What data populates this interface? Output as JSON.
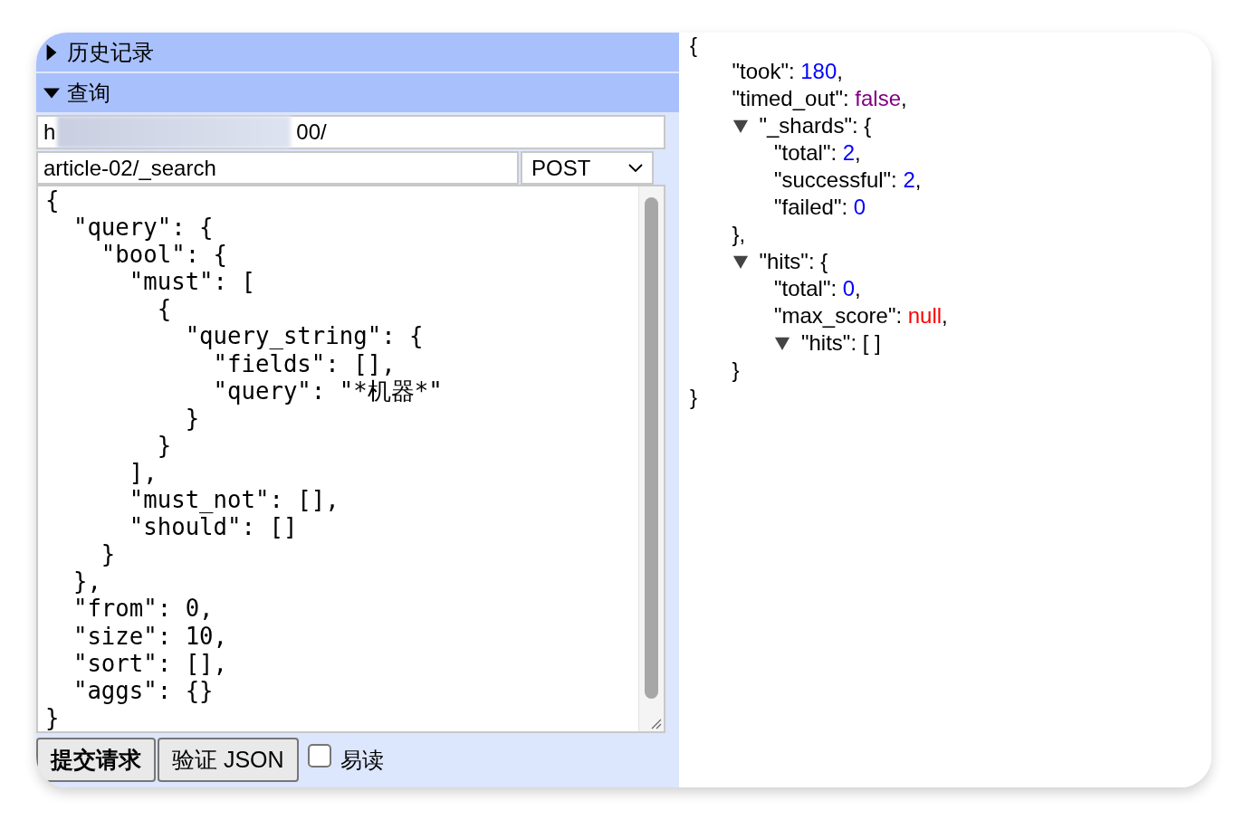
{
  "sections": [
    {
      "title": "历史记录",
      "expanded": false
    },
    {
      "title": "查询",
      "expanded": true
    }
  ],
  "query": {
    "url": {
      "prefix": "h",
      "suffix": "00/",
      "redacted": true
    },
    "path": "article-02/_search",
    "method": "POST",
    "body": "{\n  \"query\": {\n    \"bool\": {\n      \"must\": [\n        {\n          \"query_string\": {\n            \"fields\": [],\n            \"query\": \"*机器*\"\n          }\n        }\n      ],\n      \"must_not\": [],\n      \"should\": []\n    }\n  },\n  \"from\": 0,\n  \"size\": 10,\n  \"sort\": [],\n  \"aggs\": {}\n}"
  },
  "buttons": [
    {
      "label": "提交请求",
      "bold": true
    },
    {
      "label": "验证 JSON",
      "bold": false
    }
  ],
  "readable": {
    "label": "易读",
    "checked": false
  },
  "response": {
    "open": "{",
    "close": "}",
    "children": [
      {
        "label": "\"took\": ",
        "value": "180",
        "color": "#0000ff",
        "tail": ","
      },
      {
        "label": "\"timed_out\": ",
        "value": "false",
        "color": "#800080",
        "tail": ","
      },
      {
        "label": "\"_shards\": ",
        "open": "{",
        "expanded": true,
        "close": "},",
        "children": [
          {
            "label": "\"total\": ",
            "value": "2",
            "color": "#0000ff",
            "tail": ","
          },
          {
            "label": "\"successful\": ",
            "value": "2",
            "color": "#0000ff",
            "tail": ","
          },
          {
            "label": "\"failed\": ",
            "value": "0",
            "color": "#0000ff"
          }
        ]
      },
      {
        "label": "\"hits\": ",
        "open": "{",
        "expanded": true,
        "close": "}",
        "children": [
          {
            "label": "\"total\": ",
            "value": "0",
            "color": "#0000ff",
            "tail": ","
          },
          {
            "label": "\"max_score\": ",
            "value": "null",
            "color": "#ff0000",
            "tail": ","
          },
          {
            "label": "\"hits\": ",
            "open": "[ ]",
            "expanded": true
          }
        ]
      }
    ]
  }
}
